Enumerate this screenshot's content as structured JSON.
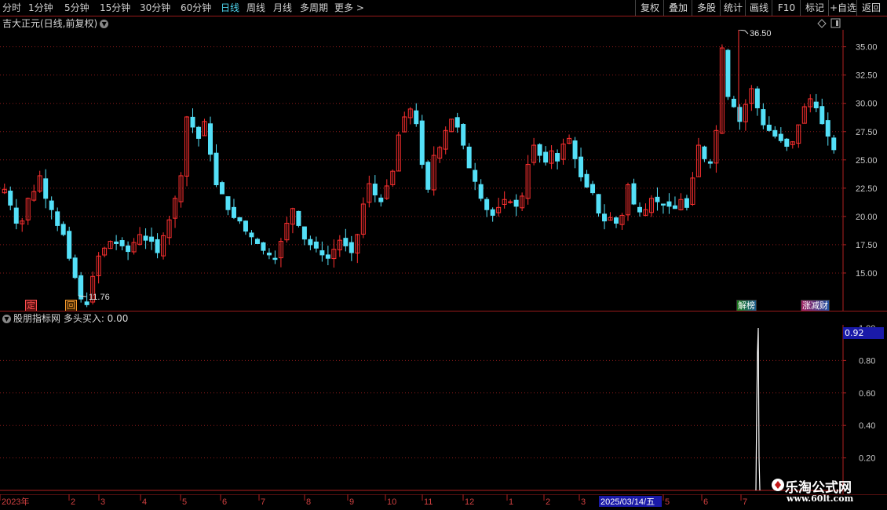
{
  "toolbar": {
    "periods": [
      "分时",
      "1分钟",
      "5分钟",
      "15分钟",
      "30分钟",
      "60分钟",
      "日线",
      "周线",
      "月线",
      "多周期",
      "更多 >"
    ],
    "active_period": "日线",
    "right_buttons": [
      "复权",
      "叠加",
      "多股",
      "统计",
      "画线",
      "F10",
      "标记",
      "+自选",
      "返回"
    ]
  },
  "main": {
    "title": "吉大正元(日线,前复权)",
    "high_label": "36.50",
    "low_label": "11.76",
    "tags": {
      "ding": "定",
      "hui": "回",
      "jiebang": "解榜",
      "zhangcai": "涨减财"
    }
  },
  "indicator": {
    "title": "股朋指标网  多头买入: 0.00",
    "value_box": "0.92"
  },
  "x_axis": {
    "labels": [
      "2023年",
      "2",
      "3",
      "4",
      "5",
      "6",
      "7",
      "8",
      "9",
      "10",
      "11",
      "12",
      "1",
      "2",
      "3",
      "2025/03/14/五",
      "5",
      "6",
      "7"
    ],
    "highlight": "2025/03/14/五"
  },
  "watermark": {
    "line1": "乐淘公式网",
    "line2": "www.60lt.com"
  },
  "colors": {
    "up": "#ff3030",
    "down": "#54e0f8",
    "grid": "#8a1a1a",
    "accent": "#4fd6f0",
    "highlight_bg": "#1a1aa8"
  },
  "chart_data": [
    {
      "type": "candlestick",
      "title": "吉大正元(日线,前复权)",
      "y_ticks": [
        "35.00",
        "32.50",
        "30.00",
        "27.50",
        "25.00",
        "22.50",
        "20.00",
        "17.50",
        "15.00"
      ],
      "ylim": [
        12.5,
        36.5
      ],
      "high_label": 36.5,
      "low_label": 11.76,
      "close_series": [
        22.4,
        21.0,
        19.4,
        19.6,
        21.6,
        22.2,
        23.6,
        21.6,
        20.6,
        19.2,
        18.4,
        16.3,
        14.6,
        12.7,
        12.2,
        14.7,
        16.5,
        17.2,
        17.8,
        17.6,
        17.4,
        16.9,
        17.7,
        18.4,
        17.9,
        17.8,
        16.8,
        18.3,
        19.7,
        21.6,
        23.6,
        28.8,
        27.9,
        26.9,
        28.4,
        25.5,
        22.8,
        22.0,
        20.6,
        19.9,
        19.6,
        18.7,
        18.2,
        17.6,
        17.0,
        16.6,
        16.2,
        17.8,
        19.4,
        20.7,
        19.2,
        18.0,
        17.5,
        17.2,
        16.6,
        16.3,
        17.1,
        17.9,
        17.4,
        16.8,
        18.4,
        21.1,
        22.9,
        21.9,
        21.3,
        22.7,
        24.0,
        27.2,
        28.8,
        29.5,
        28.2,
        24.6,
        22.4,
        25.4,
        26.1,
        27.6,
        28.6,
        27.9,
        26.3,
        24.3,
        23.1,
        21.6,
        20.6,
        20.1,
        20.8,
        21.5,
        21.3,
        20.9,
        21.8,
        24.6,
        26.3,
        25.4,
        24.8,
        25.8,
        24.9,
        26.4,
        26.9,
        25.1,
        23.5,
        22.6,
        22.1,
        20.3,
        19.6,
        19.9,
        19.4,
        20.1,
        22.8,
        21.1,
        20.4,
        20.6,
        21.6,
        21.3,
        21.0,
        20.9,
        20.7,
        21.5,
        20.8,
        23.4,
        26.3,
        25.1,
        24.7,
        27.6,
        34.9,
        30.6,
        29.7,
        28.4,
        29.9,
        31.3,
        29.6,
        28.1,
        27.6,
        27.1,
        26.7,
        26.2,
        26.6,
        28.1,
        29.7,
        30.4,
        29.6,
        28.2,
        27.1,
        25.9
      ],
      "candle_count": 140
    },
    {
      "type": "bar",
      "title": "多头买入",
      "value": 0.0,
      "y_ticks": [
        "0.80",
        "0.60",
        "0.40",
        "0.20"
      ],
      "ylim": [
        0,
        1.0
      ],
      "spike_value": 1.0,
      "marker_value": 0.92
    }
  ]
}
